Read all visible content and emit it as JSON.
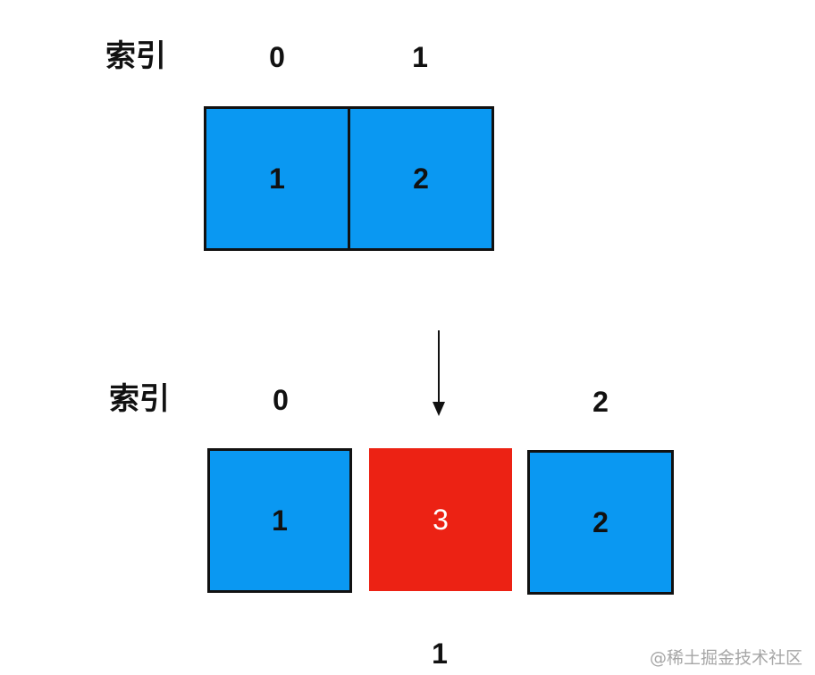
{
  "index_label": "索引",
  "before": {
    "indices": [
      "0",
      "1"
    ],
    "values": [
      "1",
      "2"
    ]
  },
  "after": {
    "indices": [
      "0",
      "2"
    ],
    "bottom_index": "1",
    "values": [
      "1",
      "3",
      "2"
    ]
  },
  "colors": {
    "existing_cell": "#0a98f2",
    "inserted_cell": "#ec2214",
    "border": "#111111"
  },
  "watermark": "@稀土掘金技术社区"
}
